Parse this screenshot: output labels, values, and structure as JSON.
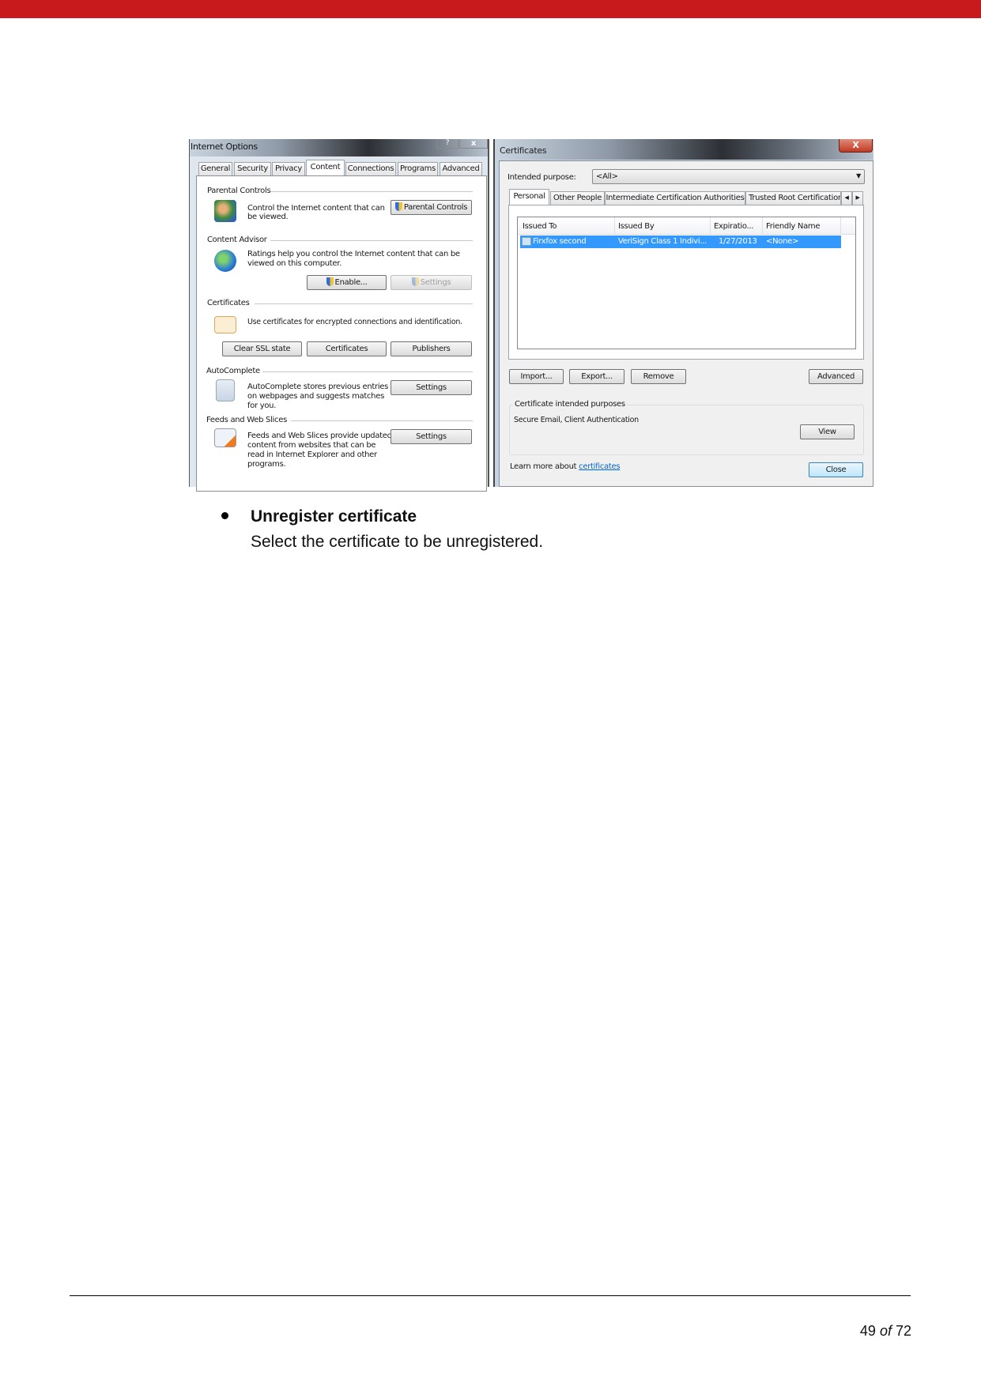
{
  "header_bar_color": "#c8191c",
  "internet_options": {
    "title": "Internet Options",
    "help": "?",
    "close": "x",
    "tabs": [
      "General",
      "Security",
      "Privacy",
      "Content",
      "Connections",
      "Programs",
      "Advanced"
    ],
    "active_tab": "Content",
    "parental_controls": {
      "heading": "Parental Controls",
      "desc_line1": "Control the Internet content that can",
      "desc_line2": "be viewed.",
      "button": "Parental Controls"
    },
    "content_advisor": {
      "heading": "Content Advisor",
      "desc_line1": "Ratings help you control the Internet content that can be",
      "desc_line2": "viewed on this computer.",
      "enable": "Enable...",
      "settings": "Settings"
    },
    "certificates": {
      "heading": "Certificates",
      "desc": "Use certificates for encrypted connections and identification.",
      "clear_ssl": "Clear SSL state",
      "certificates": "Certificates",
      "publishers": "Publishers"
    },
    "autocomplete": {
      "heading": "AutoComplete",
      "desc_line1": "AutoComplete stores previous entries",
      "desc_line2": "on webpages and suggests matches",
      "desc_line3": "for you.",
      "settings": "Settings"
    },
    "feeds": {
      "heading": "Feeds and Web Slices",
      "desc_line1": "Feeds and Web Slices provide updated",
      "desc_line2": "content from websites that can be",
      "desc_line3": "read in Internet Explorer and other",
      "desc_line4": "programs.",
      "settings": "Settings"
    }
  },
  "certificates_dialog": {
    "title": "Certificates",
    "close": "X",
    "intended_purpose_label": "Intended purpose:",
    "intended_purpose_value": "<All>",
    "tabs": [
      "Personal",
      "Other People",
      "Intermediate Certification Authorities",
      "Trusted Root Certification"
    ],
    "active_tab": "Personal",
    "columns": [
      "Issued To",
      "Issued By",
      "Expiratio...",
      "Friendly Name"
    ],
    "rows": [
      {
        "issued_to": "Firxfox second",
        "issued_by": "VeriSign Class 1 Indivi...",
        "expiration": "1/27/2013",
        "friendly_name": "<None>",
        "selected": true
      }
    ],
    "buttons": {
      "import": "Import...",
      "export": "Export...",
      "remove": "Remove",
      "advanced": "Advanced",
      "view": "View",
      "close": "Close"
    },
    "purposes_label": "Certificate intended purposes",
    "purposes_value": "Secure Email, Client Authentication",
    "learn_more": "Learn more about ",
    "learn_more_link": "certificates",
    "selection_color": "#3399ff"
  },
  "body": {
    "bullet_title": "Unregister certificate",
    "bullet_text": "Select the certificate to be unregistered."
  },
  "footer": {
    "page": "49",
    "of": "of",
    "total": "72"
  }
}
